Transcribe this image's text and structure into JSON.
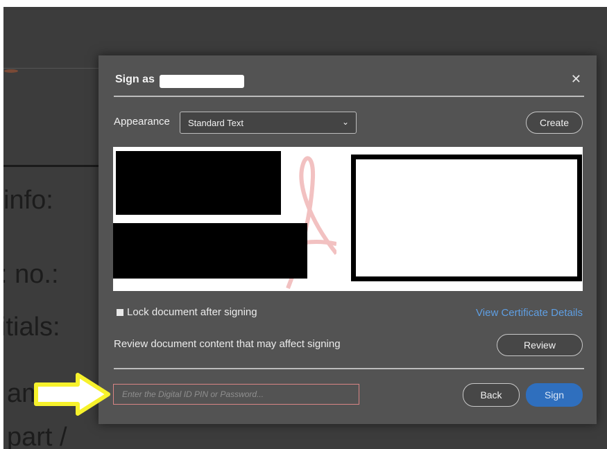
{
  "document": {
    "lines": [
      " info:",
      ": no.:",
      "itials:",
      "am",
      "part /"
    ]
  },
  "dialog": {
    "title": "Sign as",
    "close_icon": "close-icon",
    "appearance_label": "Appearance",
    "appearance_value": "Standard Text",
    "create_label": "Create",
    "lock_label": "Lock document after signing",
    "view_cert_label": "View Certificate Details",
    "review_text": "Review document content that may affect signing",
    "review_label": "Review",
    "pin_placeholder": "Enter the Digital ID PIN or Password...",
    "back_label": "Back",
    "sign_label": "Sign"
  },
  "colors": {
    "dialog_bg": "#535353",
    "link": "#5f9fe3",
    "sign_button": "#2f6fbe",
    "highlight_arrow": "#f7f22c"
  }
}
